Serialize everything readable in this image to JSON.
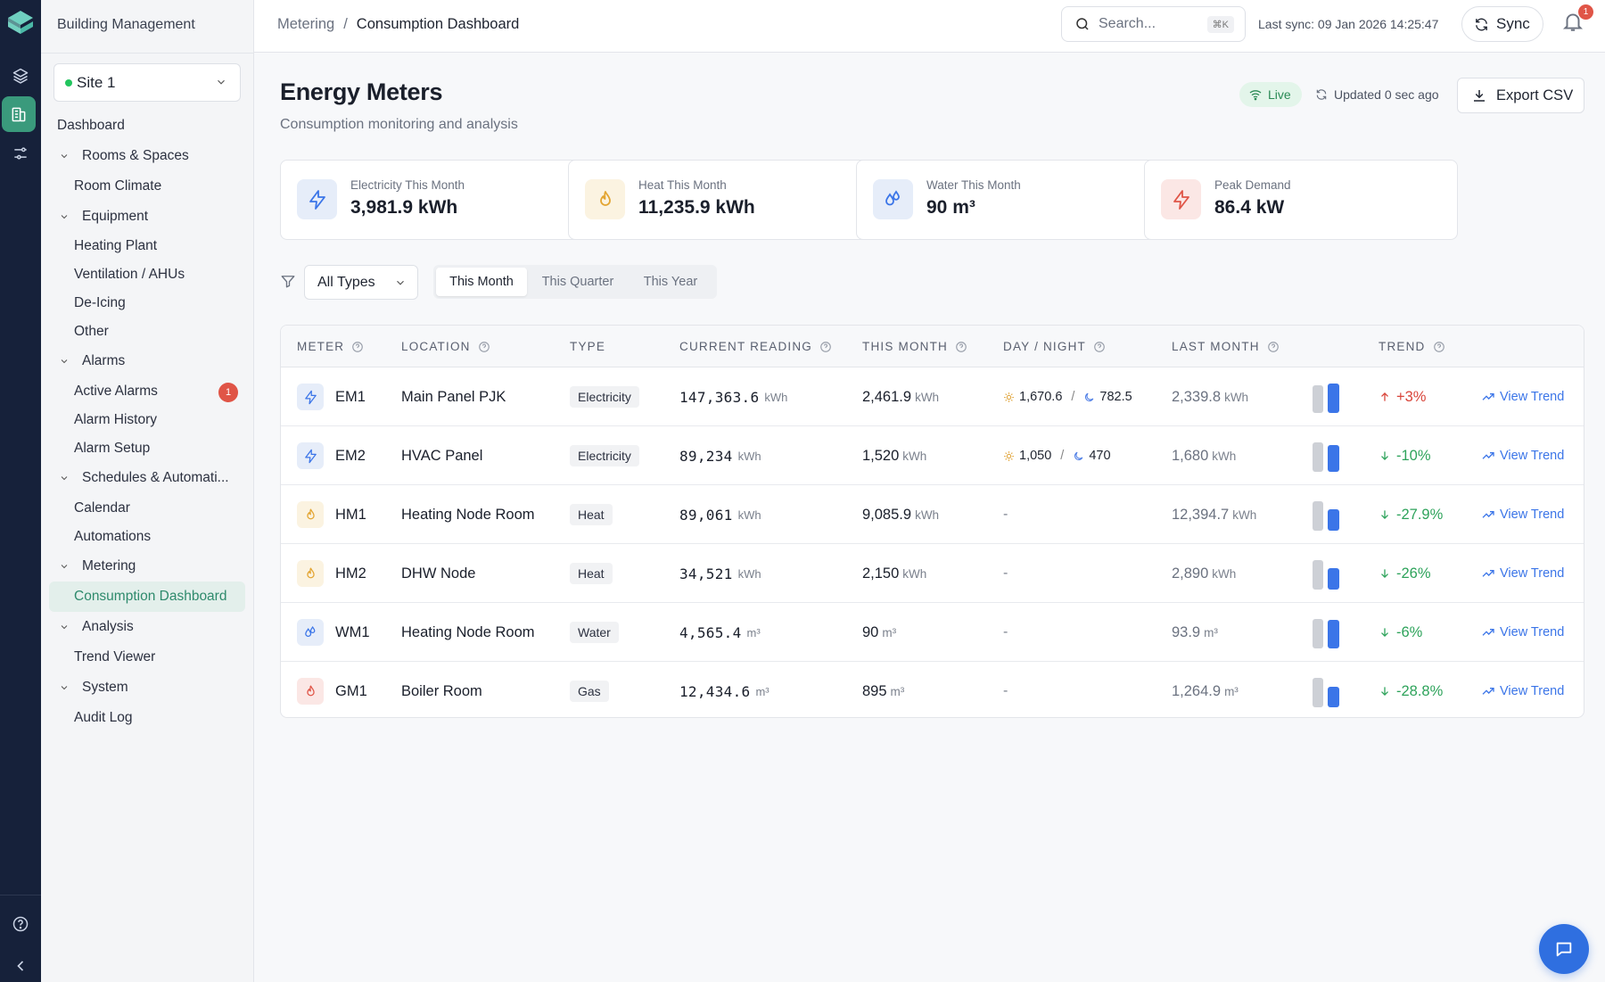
{
  "sidebar": {
    "title": "Building Management",
    "site": "Site 1",
    "nav": [
      {
        "label": "Dashboard"
      },
      {
        "label": "Rooms & Spaces"
      },
      {
        "label": "Room Climate"
      },
      {
        "label": "Equipment"
      },
      {
        "label": "Heating Plant"
      },
      {
        "label": "Ventilation / AHUs"
      },
      {
        "label": "De-Icing"
      },
      {
        "label": "Other"
      },
      {
        "label": "Alarms"
      },
      {
        "label": "Active Alarms",
        "badge": "1"
      },
      {
        "label": "Alarm History"
      },
      {
        "label": "Alarm Setup"
      },
      {
        "label": "Schedules & Automati..."
      },
      {
        "label": "Calendar"
      },
      {
        "label": "Automations"
      },
      {
        "label": "Metering"
      },
      {
        "label": "Consumption Dashboard"
      },
      {
        "label": "Analysis"
      },
      {
        "label": "Trend Viewer"
      },
      {
        "label": "System"
      },
      {
        "label": "Audit Log"
      }
    ]
  },
  "topbar": {
    "breadcrumb": [
      "Metering",
      "/",
      "Consumption Dashboard"
    ],
    "search_placeholder": "Search...",
    "search_kbd": "⌘K",
    "last_sync": "Last sync: 09 Jan 2026 14:25:47",
    "sync_label": "Sync",
    "notif_count": "1"
  },
  "page": {
    "title": "Energy Meters",
    "subtitle": "Consumption monitoring and analysis",
    "live_label": "Live",
    "updated": "Updated 0 sec ago",
    "export_label": "Export CSV"
  },
  "cards": [
    {
      "label": "Electricity This Month",
      "value": "3,981.9 kWh",
      "icon": "bolt-icon",
      "bg": "#e6edf9",
      "fg": "#3b75e8"
    },
    {
      "label": "Heat This Month",
      "value": "11,235.9 kWh",
      "icon": "flame-icon",
      "bg": "#fbf3e1",
      "fg": "#e3a532"
    },
    {
      "label": "Water This Month",
      "value": "90 m³",
      "icon": "droplets-icon",
      "bg": "#e6edf9",
      "fg": "#3b75e8"
    },
    {
      "label": "Peak Demand",
      "value": "86.4 kW",
      "icon": "bolt-icon",
      "bg": "#fbe7e5",
      "fg": "#e05547"
    }
  ],
  "filters": {
    "type_label": "All Types",
    "periods": [
      "This Month",
      "This Quarter",
      "This Year"
    ],
    "selected_period": "This Month"
  },
  "table": {
    "headers": [
      "METER",
      "LOCATION",
      "TYPE",
      "CURRENT READING",
      "THIS MONTH",
      "DAY / NIGHT",
      "LAST MONTH",
      "TREND"
    ],
    "rows": [
      {
        "meter": "EM1",
        "kind": "bolt",
        "location": "Main Panel PJK",
        "type": "Electricity",
        "reading": "147,363.6",
        "reading_unit": "kWh",
        "month": "2,461.9",
        "month_unit": "kWh",
        "day": "1,670.6",
        "night": "782.5",
        "last": "2,339.8",
        "last_unit": "kWh",
        "bar_prev": 0.95,
        "bar_cur": 1.0,
        "trend": "+3%",
        "dir": "up",
        "view": "View Trend"
      },
      {
        "meter": "EM2",
        "kind": "bolt",
        "location": "HVAC Panel",
        "type": "Electricity",
        "reading": "89,234",
        "reading_unit": "kWh",
        "month": "1,520",
        "month_unit": "kWh",
        "day": "1,050",
        "night": "470",
        "last": "1,680",
        "last_unit": "kWh",
        "bar_prev": 1.0,
        "bar_cur": 0.9,
        "trend": "-10%",
        "dir": "down",
        "view": "View Trend"
      },
      {
        "meter": "HM1",
        "kind": "flame",
        "location": "Heating Node Room",
        "type": "Heat",
        "reading": "89,061",
        "reading_unit": "kWh",
        "month": "9,085.9",
        "month_unit": "kWh",
        "day": "",
        "night": "",
        "dash": "-",
        "last": "12,394.7",
        "last_unit": "kWh",
        "bar_prev": 1.0,
        "bar_cur": 0.73,
        "trend": "-27.9%",
        "dir": "down",
        "view": "View Trend"
      },
      {
        "meter": "HM2",
        "kind": "flame",
        "location": "DHW Node",
        "type": "Heat",
        "reading": "34,521",
        "reading_unit": "kWh",
        "month": "2,150",
        "month_unit": "kWh",
        "day": "",
        "night": "",
        "dash": "-",
        "last": "2,890",
        "last_unit": "kWh",
        "bar_prev": 1.0,
        "bar_cur": 0.74,
        "trend": "-26%",
        "dir": "down",
        "view": "View Trend"
      },
      {
        "meter": "WM1",
        "kind": "droplets",
        "location": "Heating Node Room",
        "type": "Water",
        "reading": "4,565.4",
        "reading_unit": "m³",
        "month": "90",
        "month_unit": "m³",
        "day": "",
        "night": "",
        "dash": "-",
        "last": "93.9",
        "last_unit": "m³",
        "bar_prev": 1.0,
        "bar_cur": 0.96,
        "trend": "-6%",
        "dir": "down",
        "view": "View Trend"
      },
      {
        "meter": "GM1",
        "kind": "flame-red",
        "location": "Boiler Room",
        "type": "Gas",
        "reading": "12,434.6",
        "reading_unit": "m³",
        "month": "895",
        "month_unit": "m³",
        "day": "",
        "night": "",
        "dash": "-",
        "last": "1,264.9",
        "last_unit": "m³",
        "bar_prev": 1.0,
        "bar_cur": 0.71,
        "trend": "-28.8%",
        "dir": "down",
        "view": "View Trend"
      }
    ]
  }
}
